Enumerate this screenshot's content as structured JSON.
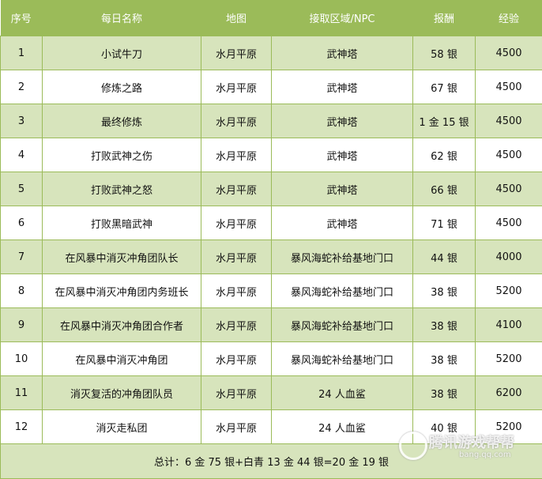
{
  "headers": [
    "序号",
    "每日名称",
    "地图",
    "接取区域/NPC",
    "报酬",
    "经验"
  ],
  "rows": [
    [
      "1",
      "小试牛刀",
      "水月平原",
      "武神塔",
      "58 银",
      "4500"
    ],
    [
      "2",
      "修炼之路",
      "水月平原",
      "武神塔",
      "67 银",
      "4500"
    ],
    [
      "3",
      "最终修炼",
      "水月平原",
      "武神塔",
      "1 金 15 银",
      "4500"
    ],
    [
      "4",
      "打败武神之伤",
      "水月平原",
      "武神塔",
      "62 银",
      "4500"
    ],
    [
      "5",
      "打败武神之怒",
      "水月平原",
      "武神塔",
      "66 银",
      "4500"
    ],
    [
      "6",
      "打败黑暗武神",
      "水月平原",
      "武神塔",
      "71 银",
      "4500"
    ],
    [
      "7",
      "在风暴中消灭冲角团队长",
      "水月平原",
      "暴风海蛇补给基地门口",
      "44 银",
      "4000"
    ],
    [
      "8",
      "在风暴中消灭冲角团内务班长",
      "水月平原",
      "暴风海蛇补给基地门口",
      "38 银",
      "5200"
    ],
    [
      "9",
      "在风暴中消灭冲角团合作者",
      "水月平原",
      "暴风海蛇补给基地门口",
      "38 银",
      "4100"
    ],
    [
      "10",
      "在风暴中消灭冲角团",
      "水月平原",
      "暴风海蛇补给基地门口",
      "38 银",
      "5200"
    ],
    [
      "11",
      "消灭复活的冲角团队员",
      "水月平原",
      "24 人血鲨",
      "38 银",
      "6200"
    ],
    [
      "12",
      "消灭走私团",
      "水月平原",
      "24 人血鲨",
      "40 银",
      "5200"
    ]
  ],
  "total": "总计：6 金 75 银+白青 13 金 44 银=20 金 19 银",
  "watermark": {
    "brand": "腾讯游戏帮帮",
    "url": "bang.qq.com"
  },
  "colors": {
    "header": "#9bbb59",
    "odd_row": "#d7e4bc"
  }
}
